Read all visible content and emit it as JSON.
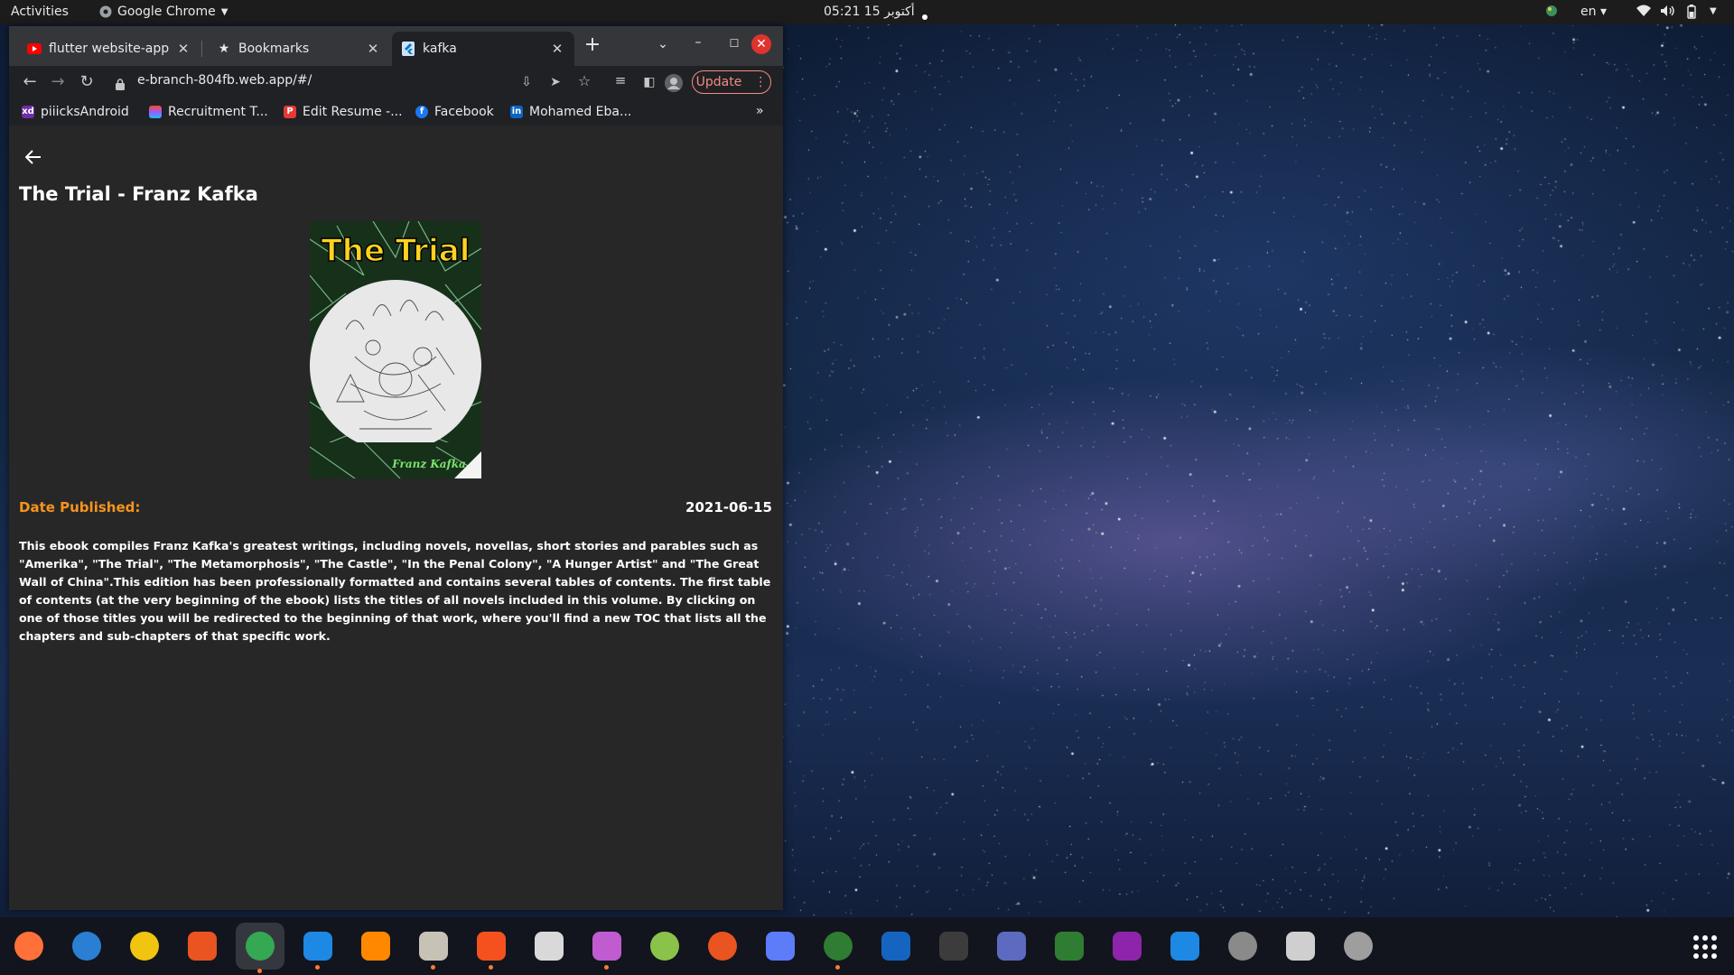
{
  "topbar": {
    "activities": "Activities",
    "app_name": "Google Chrome",
    "clock": "05:21  15 أكتوبر",
    "lang": "en"
  },
  "browser": {
    "tabs": [
      {
        "title": "flutter website-app",
        "icon": "youtube-icon"
      },
      {
        "title": "Bookmarks",
        "icon": "star-icon"
      },
      {
        "title": "kafka",
        "icon": "flutter-icon"
      }
    ],
    "url": "e-branch-804fb.web.app/#/",
    "update_label": "Update",
    "bookmarks": [
      {
        "label": "piiicksAndroid",
        "color": "#6f2da8"
      },
      {
        "label": "Recruitment T...",
        "color": "#a259ff"
      },
      {
        "label": "Edit Resume -...",
        "color": "#e53935"
      },
      {
        "label": "Facebook",
        "color": "#1877f2"
      },
      {
        "label": "Mohamed Eba...",
        "color": "#0a66c2"
      }
    ],
    "more_bookmarks": "»"
  },
  "page": {
    "title": "The Trial - Franz Kafka",
    "cover": {
      "title": "The Trial",
      "author": "Franz Kafka"
    },
    "date_label": "Date Published:",
    "date_value": "2021-06-15",
    "description": "This ebook compiles Franz Kafka's greatest writings, including novels, novellas, short stories and parables such as \"Amerika\", \"The Trial\", \"The Metamorphosis\", \"The Castle\", \"In the Penal Colony\", \"A Hunger Artist\" and \"The Great Wall of China\".This edition has been professionally formatted and contains several tables of contents. The first table of contents (at the very beginning of the ebook) lists the titles of all novels included in this volume. By clicking on one of those titles you will be redirected to the beginning of that work, where you'll find a new TOC that lists all the chapters and sub-chapters of that specific work."
  },
  "colors": {
    "accent": "#f7941d",
    "page_bg": "#272727",
    "update": "#f28b82"
  },
  "dock": [
    {
      "name": "firefox-icon",
      "color": "#ff7139",
      "running": false
    },
    {
      "name": "thunderbird-icon",
      "color": "#2a7fd4",
      "running": false
    },
    {
      "name": "rhythmbox-icon",
      "color": "#f1c40f",
      "running": false
    },
    {
      "name": "software-center-icon",
      "color": "#e95420",
      "running": false
    },
    {
      "name": "chrome-icon",
      "color": "#34a853",
      "running": true
    },
    {
      "name": "app-store-icon",
      "color": "#1e88e5",
      "running": true
    },
    {
      "name": "vlc-icon",
      "color": "#ff8800",
      "running": false
    },
    {
      "name": "files-icon",
      "color": "#c8c2b6",
      "running": true
    },
    {
      "name": "draw-icon",
      "color": "#f4511e",
      "running": true
    },
    {
      "name": "document-viewer-icon",
      "color": "#d9d9d9",
      "running": false
    },
    {
      "name": "video-player-icon",
      "color": "#c05ccf",
      "running": true
    },
    {
      "name": "android-icon",
      "color": "#8bc34a",
      "running": false
    },
    {
      "name": "ubuntu-icon",
      "color": "#e95420",
      "running": false
    },
    {
      "name": "tasks-icon",
      "color": "#5c7cfa",
      "running": false
    },
    {
      "name": "globe-icon",
      "color": "#2e7d32",
      "running": true
    },
    {
      "name": "writer-icon",
      "color": "#1565c0",
      "running": false
    },
    {
      "name": "terminal-icon",
      "color": "#3c3c3c",
      "running": false
    },
    {
      "name": "screenshot-icon",
      "color": "#5c6bc0",
      "running": false
    },
    {
      "name": "calc-icon",
      "color": "#2e7d32",
      "running": false
    },
    {
      "name": "intellij-icon",
      "color": "#8e24aa",
      "running": false
    },
    {
      "name": "vscode-icon",
      "color": "#1e88e5",
      "running": false
    },
    {
      "name": "updater-icon",
      "color": "#8a8a8a",
      "running": false
    },
    {
      "name": "usb-icon",
      "color": "#cfcfcf",
      "running": false
    },
    {
      "name": "disk-icon",
      "color": "#9e9e9e",
      "running": false
    }
  ]
}
